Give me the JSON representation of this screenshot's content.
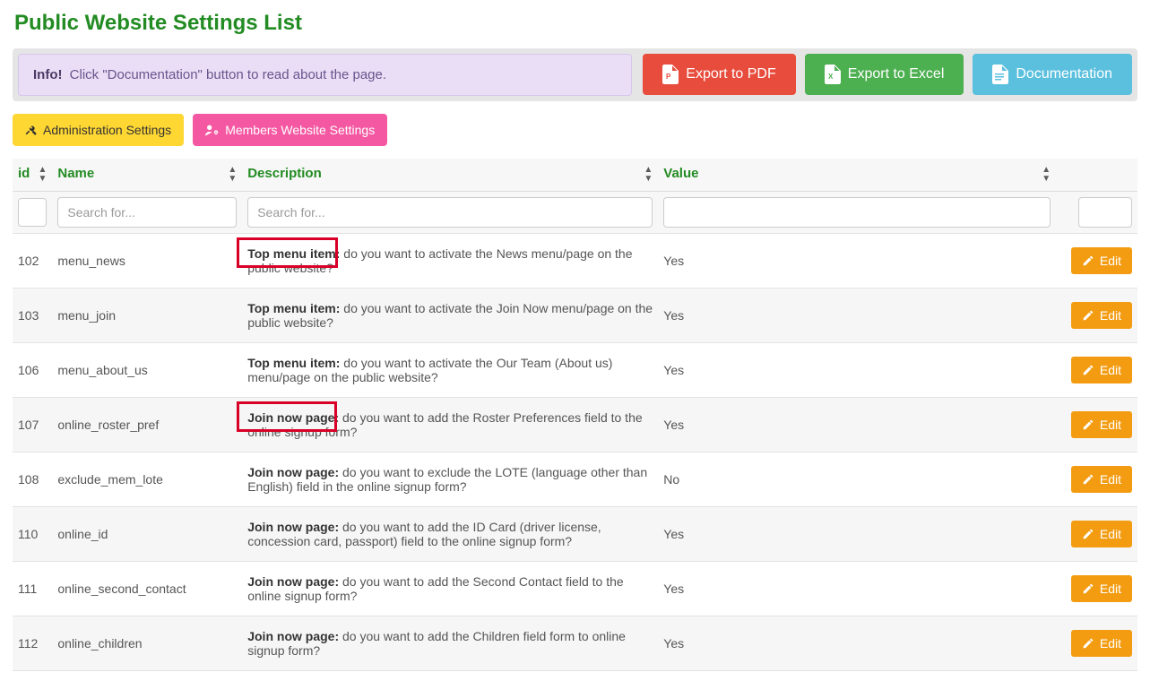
{
  "page_title": "Public Website Settings List",
  "info_label": "Info!",
  "info_text": " Click \"Documentation\" button to read about the page.",
  "buttons": {
    "export_pdf": "Export to PDF",
    "export_excel": "Export to Excel",
    "documentation": "Documentation",
    "admin_settings": "Administration Settings",
    "members_settings": "Members Website Settings",
    "edit": "Edit"
  },
  "columns": {
    "id": "id",
    "name": "Name",
    "description": "Description",
    "value": "Value"
  },
  "filters": {
    "name_placeholder": "Search for...",
    "desc_placeholder": "Search for..."
  },
  "rows": [
    {
      "id": "102",
      "name": "menu_news",
      "desc_bold": "Top menu item:",
      "desc_rest": " do you want to activate the News menu/page on the public website?",
      "value": "Yes"
    },
    {
      "id": "103",
      "name": "menu_join",
      "desc_bold": "Top menu item:",
      "desc_rest": " do you want to activate the Join Now menu/page on the public website?",
      "value": "Yes"
    },
    {
      "id": "106",
      "name": "menu_about_us",
      "desc_bold": "Top menu item:",
      "desc_rest": " do you want to activate the Our Team (About us) menu/page on the public website?",
      "value": "Yes"
    },
    {
      "id": "107",
      "name": "online_roster_pref",
      "desc_bold": "Join now page:",
      "desc_rest": " do you want to add the Roster Preferences field to the online signup form?",
      "value": "Yes"
    },
    {
      "id": "108",
      "name": "exclude_mem_lote",
      "desc_bold": "Join now page:",
      "desc_rest": " do you want to exclude the LOTE (language other than English) field in the online signup form?",
      "value": "No"
    },
    {
      "id": "110",
      "name": "online_id",
      "desc_bold": "Join now page:",
      "desc_rest": " do you want to add the ID Card (driver license, concession card, passport) field to the online signup form?",
      "value": "Yes"
    },
    {
      "id": "111",
      "name": "online_second_contact",
      "desc_bold": "Join now page:",
      "desc_rest": " do you want to add the Second Contact field to the online signup form?",
      "value": "Yes"
    },
    {
      "id": "112",
      "name": "online_children",
      "desc_bold": "Join now page:",
      "desc_rest": " do you want to add the Children field form to online signup form?",
      "value": "Yes"
    }
  ]
}
